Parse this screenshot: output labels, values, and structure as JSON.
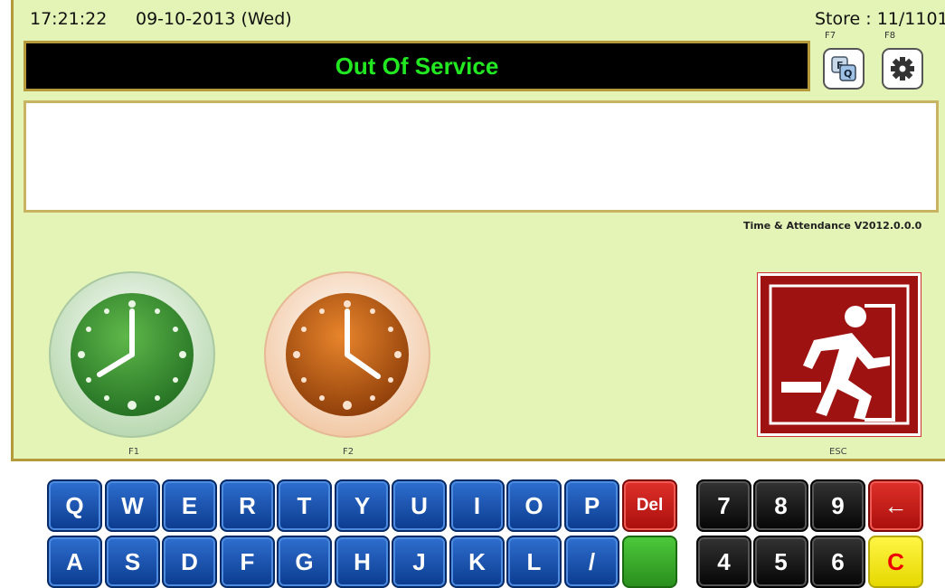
{
  "header": {
    "time": "17:21:22",
    "date": "09-10-2013 (Wed)",
    "store": "Store : 11/1101",
    "f7_label": "F7",
    "f8_label": "F8"
  },
  "status_banner": {
    "text": "Out Of Service"
  },
  "message_box": {
    "text": ""
  },
  "version": "Time & Attendance V2012.0.0.0",
  "actions": {
    "clock_in_label": "F1",
    "clock_out_label": "F2",
    "exit_label": "ESC"
  },
  "keyboard": {
    "row1": [
      "Q",
      "W",
      "E",
      "R",
      "T",
      "Y",
      "U",
      "I",
      "O",
      "P"
    ],
    "del": "Del",
    "row2": [
      "A",
      "S",
      "D",
      "F",
      "G",
      "H",
      "J",
      "K",
      "L",
      "/"
    ],
    "numpad_row1": [
      "7",
      "8",
      "9"
    ],
    "numpad_row2": [
      "4",
      "5",
      "6"
    ],
    "backspace": "←",
    "clear": "C"
  },
  "colors": {
    "panel_bg": "#e3f4b6",
    "banner_text": "#22e822",
    "border_gold": "#b49a3a",
    "clock_in": "#2f8f2f",
    "clock_out": "#c45f10",
    "exit_red": "#9e1212"
  }
}
